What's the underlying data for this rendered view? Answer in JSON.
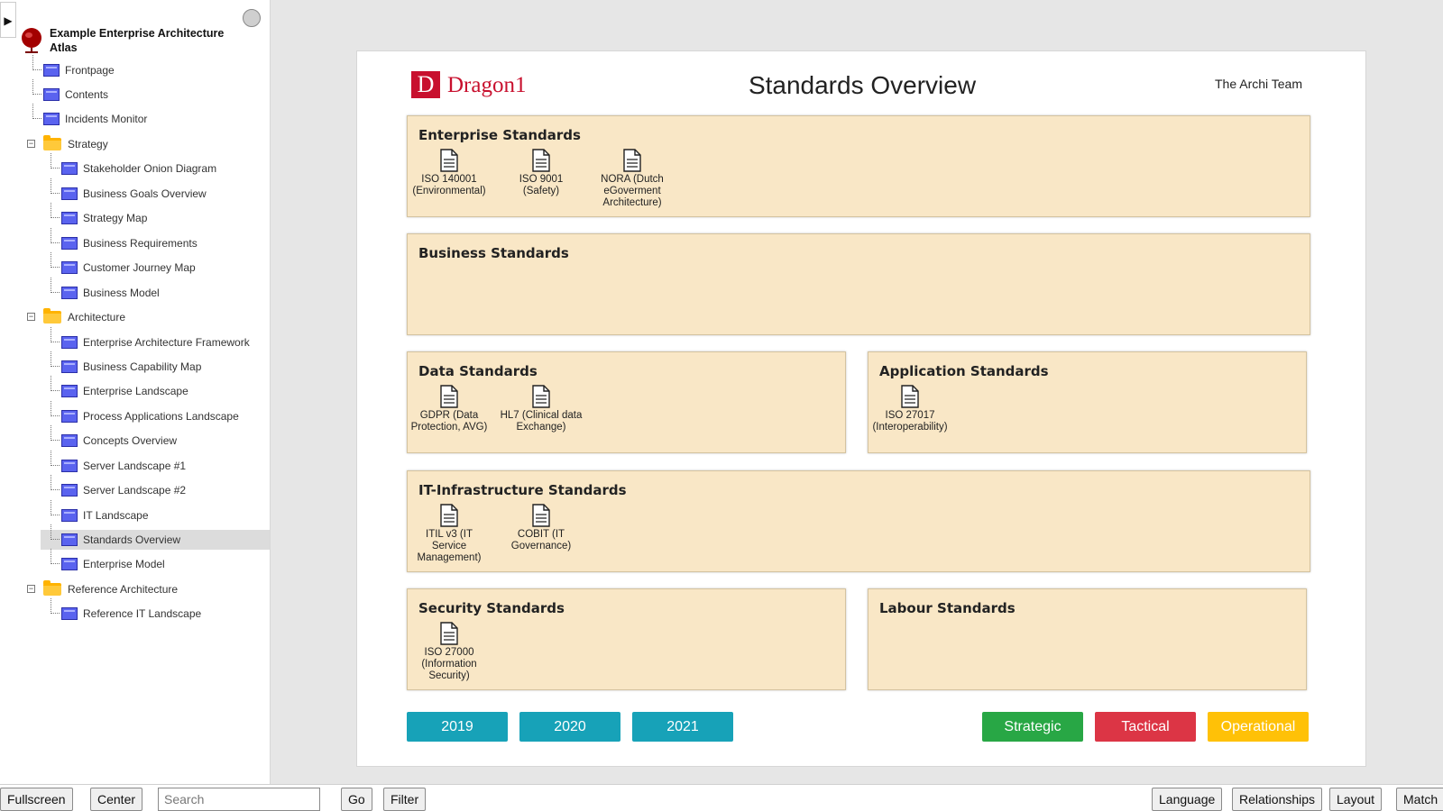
{
  "sidebar": {
    "root_label": "Example Enterprise Architecture Atlas",
    "items": [
      {
        "label": "Frontpage"
      },
      {
        "label": "Contents"
      },
      {
        "label": "Incidents Monitor"
      },
      {
        "label": "Strategy"
      },
      {
        "label": "Stakeholder Onion Diagram"
      },
      {
        "label": "Business Goals Overview"
      },
      {
        "label": "Strategy Map"
      },
      {
        "label": "Business Requirements"
      },
      {
        "label": "Customer Journey Map"
      },
      {
        "label": "Business Model"
      },
      {
        "label": "Architecture"
      },
      {
        "label": "Enterprise Architecture Framework"
      },
      {
        "label": "Business Capability Map"
      },
      {
        "label": "Enterprise Landscape"
      },
      {
        "label": "Process Applications Landscape"
      },
      {
        "label": "Concepts Overview"
      },
      {
        "label": "Server Landscape #1"
      },
      {
        "label": "Server Landscape #2"
      },
      {
        "label": "IT Landscape"
      },
      {
        "label": "Standards Overview"
      },
      {
        "label": "Enterprise Model"
      },
      {
        "label": "Reference Architecture"
      },
      {
        "label": "Reference IT Landscape"
      }
    ],
    "toggle_glyph": "▶",
    "expander_glyph": "−"
  },
  "canvas": {
    "logo_letter": "D",
    "logo_text": "Dragon1",
    "title": "Standards Overview",
    "team": "The Archi Team",
    "groups": {
      "enterprise": {
        "title": "Enterprise Standards",
        "items": [
          "ISO 140001 (Environmental)",
          "ISO 9001 (Safety)",
          "NORA (Dutch eGoverment Architecture)"
        ]
      },
      "business": {
        "title": "Business Standards"
      },
      "data": {
        "title": "Data Standards",
        "items": [
          "GDPR (Data Protection, AVG)",
          "HL7 (Clinical data Exchange)"
        ]
      },
      "application": {
        "title": "Application Standards",
        "items": [
          "ISO 27017 (Interoperability)"
        ]
      },
      "infra": {
        "title": "IT-Infrastructure Standards",
        "items": [
          "ITIL v3 (IT Service Management)",
          "COBIT (IT Governance)"
        ]
      },
      "security": {
        "title": "Security Standards",
        "items": [
          "ISO 27000 (Information Security)"
        ]
      },
      "labour": {
        "title": "Labour Standards"
      }
    },
    "years": [
      "2019",
      "2020",
      "2021"
    ],
    "levels": [
      {
        "label": "Strategic",
        "color": "#28a745"
      },
      {
        "label": "Tactical",
        "color": "#dc3545"
      },
      {
        "label": "Operational",
        "color": "#ffc107"
      }
    ]
  },
  "toolbar": {
    "fullscreen": "Fullscreen",
    "center": "Center",
    "search_placeholder": "Search",
    "go": "Go",
    "filter": "Filter",
    "language": "Language",
    "relationships": "Relationships",
    "layout": "Layout",
    "match": "Match"
  },
  "colors": {
    "group_fill": "#f9e7c6",
    "year_button": "#17a2b8",
    "logo_red": "#c8102e"
  }
}
